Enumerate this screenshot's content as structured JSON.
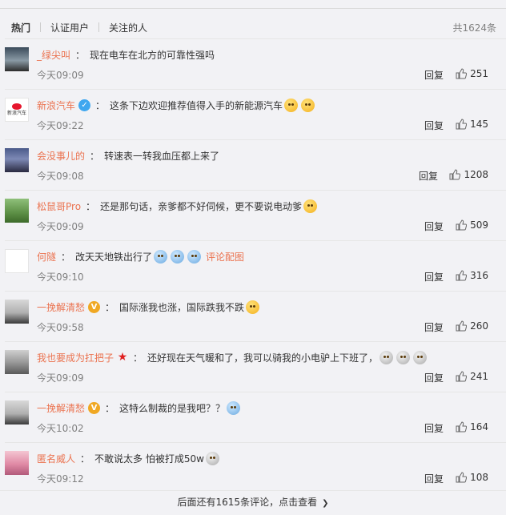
{
  "tabs": {
    "hot": "热门",
    "verified": "认证用户",
    "following": "关注的人"
  },
  "total": "共1624条",
  "comments": [
    {
      "user": "_绿尖叫",
      "text": "现在电车在北方的可靠性强吗",
      "time": "今天09:09",
      "reply": "回复",
      "likes": "251"
    },
    {
      "user": "新浪汽车",
      "text": "这条下边欢迎推荐值得入手的新能源汽车",
      "time": "今天09:22",
      "reply": "回复",
      "likes": "145",
      "avatar_text": "新浪汽车"
    },
    {
      "user": "会没事儿的",
      "text": "转速表一转我血压都上来了",
      "time": "今天09:08",
      "reply": "回复",
      "likes": "1208"
    },
    {
      "user": "松鼠哥Pro",
      "text": "还是那句话，亲爹都不好伺候，更不要说电动爹",
      "time": "今天09:09",
      "reply": "回复",
      "likes": "509"
    },
    {
      "user": "何隧",
      "text": "改天天地铁出行了",
      "time": "今天09:10",
      "reply": "回复",
      "likes": "316",
      "pic_link": "评论配图"
    },
    {
      "user": "一挽解清愁",
      "text": "国际涨我也涨，国际跌我不跌",
      "time": "今天09:58",
      "reply": "回复",
      "likes": "260"
    },
    {
      "user": "我也要成为扛把子",
      "text": "还好现在天气暖和了，我可以骑我的小电驴上下班了，",
      "time": "今天09:09",
      "reply": "回复",
      "likes": "241"
    },
    {
      "user": "一挽解清愁",
      "text": "这特么制裁的是我吧？？",
      "time": "今天10:02",
      "reply": "回复",
      "likes": "164"
    },
    {
      "user": "匿名威人",
      "text": "不敢说太多 怕被打成50w",
      "time": "今天09:12",
      "reply": "回复",
      "likes": "108"
    }
  ],
  "more": {
    "label": "后面还有1615条评论，点击查看"
  },
  "colors": {
    "username": "#eb7350",
    "verified_blue": "#3fa7ef",
    "verified_gold": "#f0a823"
  }
}
